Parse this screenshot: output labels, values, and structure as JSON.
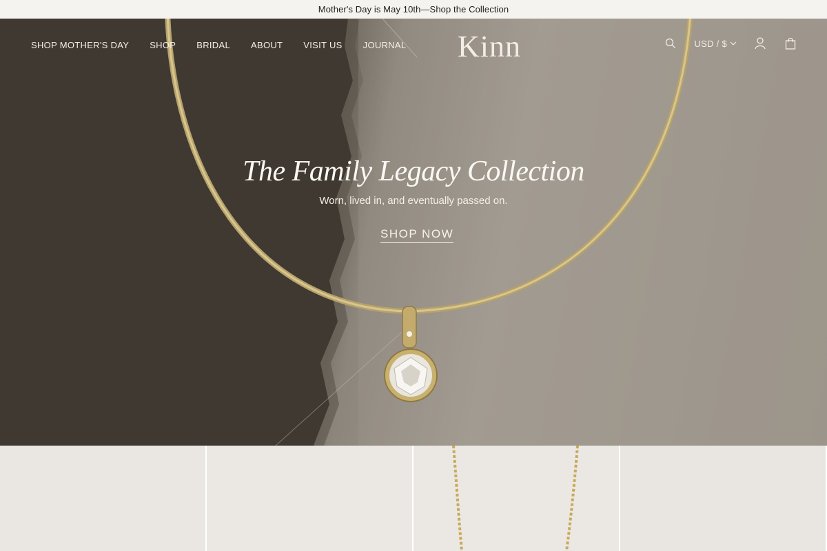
{
  "announcement": {
    "text": "Mother's Day is May 10th—Shop the Collection"
  },
  "nav": {
    "items": [
      {
        "label": "SHOP MOTHER'S DAY"
      },
      {
        "label": "SHOP"
      },
      {
        "label": "BRIDAL"
      },
      {
        "label": "ABOUT"
      },
      {
        "label": "VISIT US"
      },
      {
        "label": "JOURNAL"
      }
    ]
  },
  "brand": {
    "logo_text": "Kinn"
  },
  "tools": {
    "search_icon": "search-icon",
    "currency_label": "USD / $",
    "account_icon": "user-icon",
    "cart_icon": "bag-icon"
  },
  "hero": {
    "title": "The Family Legacy Collection",
    "subtitle": "Worn, lived in, and eventually passed on.",
    "cta": "SHOP NOW"
  },
  "colors": {
    "announcement_bg": "#f4f3ef",
    "hero_text": "#fbf8f3",
    "gold": "#c9b57a"
  }
}
